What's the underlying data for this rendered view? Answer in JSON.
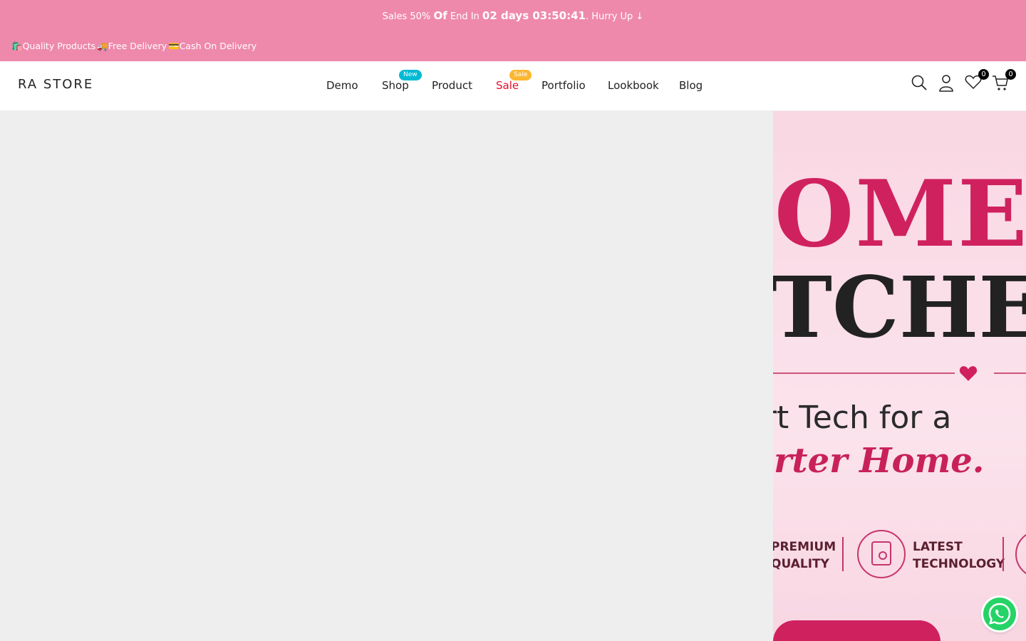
{
  "topbar": {
    "promo_prefix": "Sales 50%",
    "promo_of": "Of",
    "promo_mid": "End In",
    "countdown": "02 days 03:50:41",
    "promo_suffix": ". Hurry Up ↓",
    "features": [
      "🛍️Quality Products",
      "🚚Free Delivery",
      "💳Cash On Delivery"
    ]
  },
  "header": {
    "logo": "RA STORE",
    "nav": [
      {
        "label": "Demo",
        "badge": ""
      },
      {
        "label": "Shop",
        "badge": "New"
      },
      {
        "label": "Product",
        "badge": ""
      },
      {
        "label": "Sale",
        "badge": "Sale"
      },
      {
        "label": "Portfolio",
        "badge": ""
      },
      {
        "label": "Lookbook",
        "badge": ""
      },
      {
        "label": "Blog",
        "badge": ""
      }
    ],
    "wishlist_count": "0",
    "cart_count": "0"
  },
  "hero": {
    "line1": "IOME",
    "line2": "ITCHE",
    "tagline1": "art Tech for a",
    "tagline2": "arter Home.",
    "feature1_l1": "PREMIUM",
    "feature1_l2": "QUALITY",
    "feature2_l1": "LATEST",
    "feature2_l2": "TECHNOLOGY"
  },
  "colors": {
    "topbar_bg": "#ee89ac",
    "sale_link": "#e00f2b",
    "badge_new": "#01bad4",
    "badge_sale": "#fcb731",
    "hero_accent": "#d0215f",
    "whatsapp": "#25d366"
  },
  "icons": [
    "search-icon",
    "user-icon",
    "heart-icon",
    "cart-icon",
    "whatsapp-icon"
  ]
}
